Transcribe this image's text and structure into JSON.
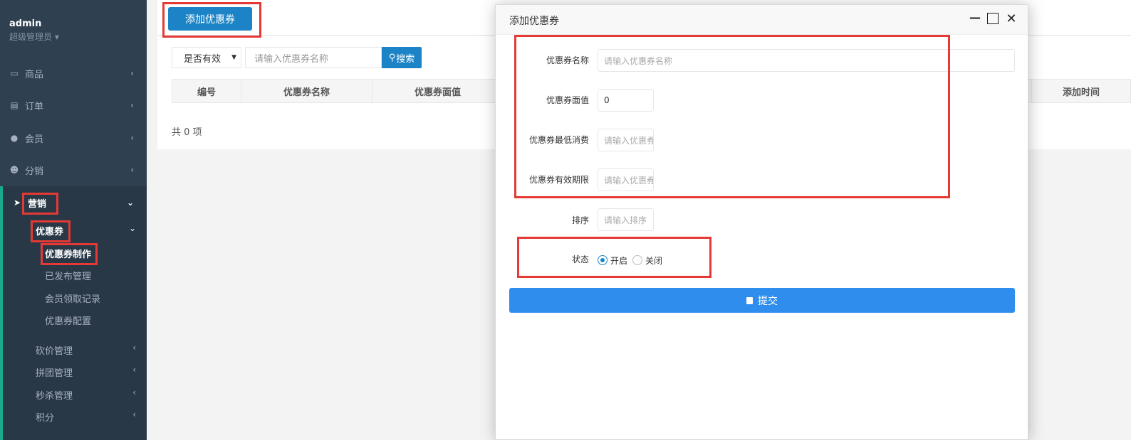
{
  "sidebar": {
    "user": "admin",
    "role": "超级管理员",
    "items": [
      {
        "label": "商品",
        "icon": "laptop-icon"
      },
      {
        "label": "订单",
        "icon": "file-icon"
      },
      {
        "label": "会员",
        "icon": "user-icon"
      },
      {
        "label": "分销",
        "icon": "users-icon"
      },
      {
        "label": "营销",
        "icon": "paper-plane-icon"
      }
    ],
    "coupon_group": "优惠券",
    "coupon_sub": [
      "优惠券制作",
      "已发布管理",
      "会员领取记录",
      "优惠券配置"
    ],
    "more": [
      "砍价管理",
      "拼团管理",
      "秒杀管理",
      "积分"
    ]
  },
  "toolbar": {
    "add_button": "添加优惠券",
    "filter_select": "是否有效",
    "search_placeholder": "请输入优惠券名称",
    "search_button": "搜索"
  },
  "table": {
    "columns": [
      "编号",
      "优惠券名称",
      "优惠券面值",
      "添加时间"
    ],
    "total": "共 0 项"
  },
  "modal": {
    "title": "添加优惠券",
    "fields": [
      {
        "label": "优惠券名称",
        "placeholder": "请输入优惠券名称",
        "value": ""
      },
      {
        "label": "优惠券面值",
        "placeholder": "",
        "value": "0"
      },
      {
        "label": "优惠券最低消费",
        "placeholder": "请输入优惠券最低消费",
        "value": ""
      },
      {
        "label": "优惠券有效期限",
        "placeholder": "请输入优惠券有效期限",
        "value": ""
      },
      {
        "label": "排序",
        "placeholder": "请输入排序",
        "value": ""
      }
    ],
    "status_label": "状态",
    "status_options": [
      "开启",
      "关闭"
    ],
    "status_selected": "开启",
    "submit": "提交"
  },
  "colors": {
    "sidebar_bg": "#2f4050",
    "primary": "#1c84c6",
    "submit": "#2e8ded",
    "highlight": "#e53935"
  }
}
